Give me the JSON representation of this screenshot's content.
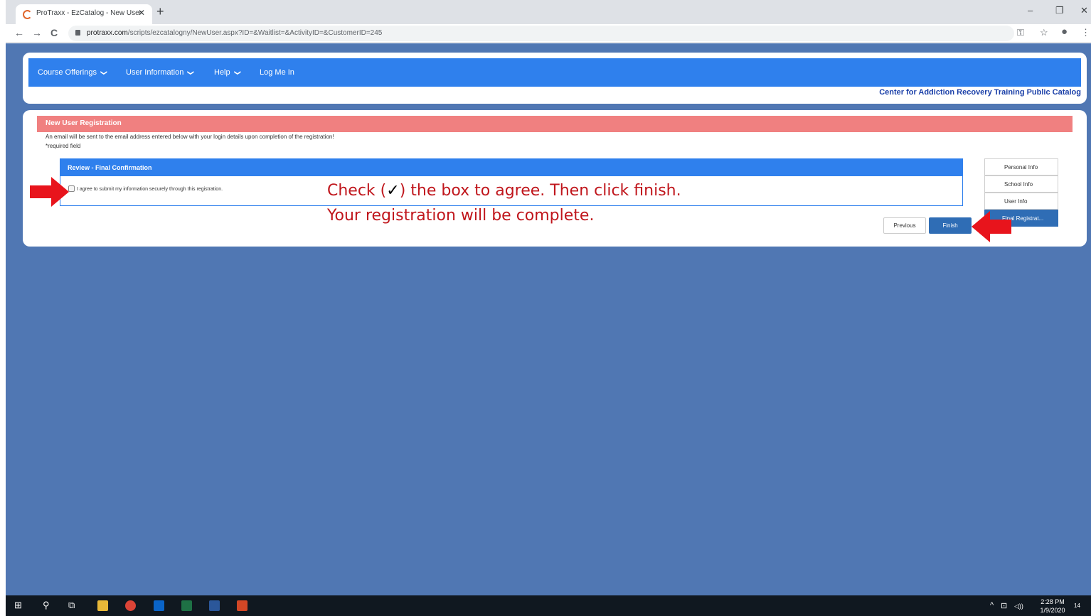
{
  "browser": {
    "tab_title": "ProTraxx - EzCatalog - New User",
    "tab_close": "✕",
    "new_tab": "+",
    "url_host": "protraxx.com",
    "url_path": "/scripts/ezcatalogny/NewUser.aspx?ID=&Waitlist=&ActivityID=&CustomerID=245",
    "window_minimize": "–",
    "window_restore": "❐",
    "window_close": "✕",
    "nav_back": "←",
    "nav_forward": "→",
    "nav_reload": "C",
    "key_icon": "⚿",
    "star_icon": "☆",
    "menu_icon": "⋮"
  },
  "nav": {
    "items": [
      {
        "label": "Course Offerings",
        "has_dropdown": true
      },
      {
        "label": "User Information",
        "has_dropdown": true
      },
      {
        "label": "Help",
        "has_dropdown": true
      },
      {
        "label": "Log Me In",
        "has_dropdown": false
      }
    ],
    "chevron": "❯",
    "catalog_title": "Center for Addiction Recovery Training Public Catalog"
  },
  "registration": {
    "banner_title": "New User Registration",
    "notice": "An email will be sent to the email address entered below with your login details upon completion of the registration!",
    "required_note": "*required field",
    "panel_title": "Review - Final Confirmation",
    "agree_label": "I agree to submit my information securely through this registration.",
    "agree_checked": false,
    "steps": [
      {
        "label": "Personal Info",
        "active": false
      },
      {
        "label": "School Info",
        "active": false
      },
      {
        "label": "User Info",
        "active": false
      },
      {
        "label": "Final Registrat...",
        "active": true
      }
    ],
    "previous_label": "Previous",
    "finish_label": "Finish"
  },
  "annotation": {
    "line1_before": "Check (",
    "line1_check": "✓",
    "line1_after": ") the box to agree. Then click finish.",
    "line2": "Your registration will be complete."
  },
  "taskbar": {
    "time": "2:28 PM",
    "date": "1/9/2020",
    "tray_chevron": "^",
    "tray_network": "⊡",
    "tray_volume": "◁))",
    "notification_count": "14"
  },
  "colors": {
    "page_bg": "#5077b3",
    "menubar": "#2f80ed",
    "banner": "#f08080",
    "annotation_red": "#c0161c",
    "arrow_red": "#e8141c",
    "finish_blue": "#2f6db5"
  }
}
